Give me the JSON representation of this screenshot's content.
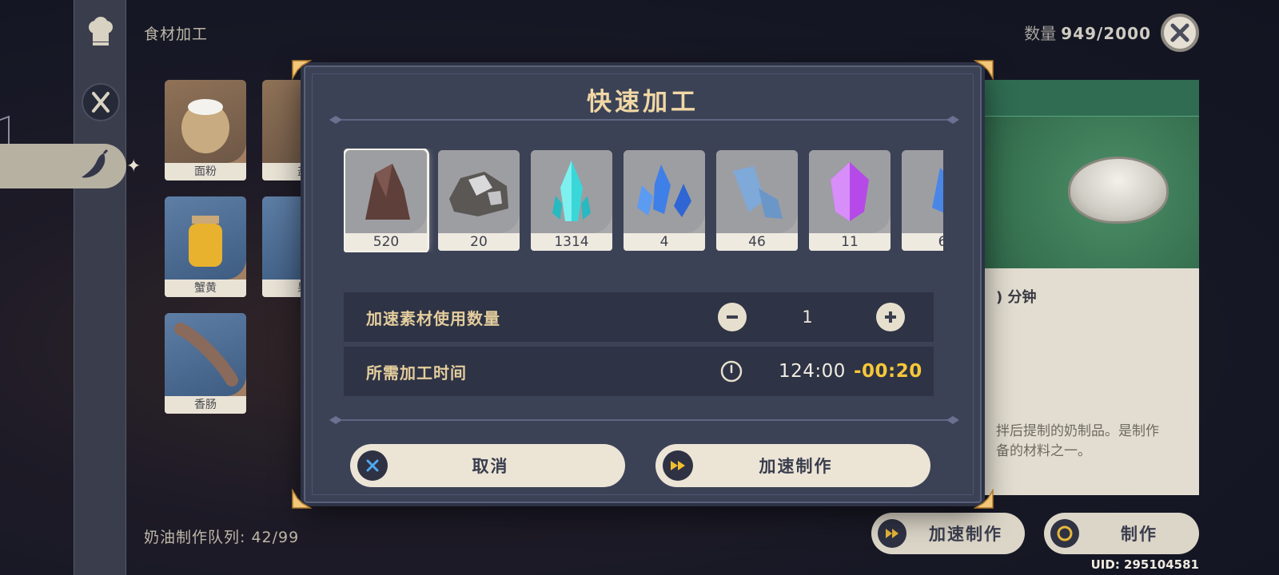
{
  "header": {
    "title": "食材加工",
    "count_label": "数量",
    "count_value": "949/2000"
  },
  "background_items": [
    {
      "label": "面粉",
      "icon": "flour-sack-icon"
    },
    {
      "label": "盐",
      "icon": "meat-icon"
    },
    {
      "label": "蟹黄",
      "icon": "crab-roe-jar-icon"
    },
    {
      "label": "果",
      "icon": "jar-icon"
    },
    {
      "label": "香肠",
      "icon": "sausage-icon"
    }
  ],
  "queue_text": "奶油制作队列: 42/99",
  "detail": {
    "minutes_text": ") 分钟",
    "desc_line1": "拌后提制的奶制品。是制作",
    "desc_line2": "备的材料之一。"
  },
  "bottom_buttons": {
    "speed_label": "加速制作",
    "make_label": "制作"
  },
  "uid": "UID: 295104581",
  "modal": {
    "title": "快速加工",
    "materials": [
      {
        "count": "520",
        "icon": "dark-ore-icon",
        "selected": true
      },
      {
        "count": "20",
        "icon": "silver-ore-icon",
        "selected": false
      },
      {
        "count": "1314",
        "icon": "cyan-crystal-icon",
        "selected": false
      },
      {
        "count": "4",
        "icon": "blue-crystal-cluster-icon",
        "selected": false
      },
      {
        "count": "46",
        "icon": "pale-blue-crystal-icon",
        "selected": false
      },
      {
        "count": "11",
        "icon": "purple-gem-icon",
        "selected": false
      },
      {
        "count": "6",
        "icon": "blue-crystal-icon",
        "selected": false
      }
    ],
    "quantity_label": "加速素材使用数量",
    "quantity_value": "1",
    "time_label": "所需加工时间",
    "time_value": "124:00",
    "time_reduction": "-00:20",
    "cancel_label": "取消",
    "confirm_label": "加速制作"
  },
  "colors": {
    "title_gold": "#f0d7a5",
    "reduction_yellow": "#f5c73a",
    "modal_bg": "#3c4256"
  }
}
